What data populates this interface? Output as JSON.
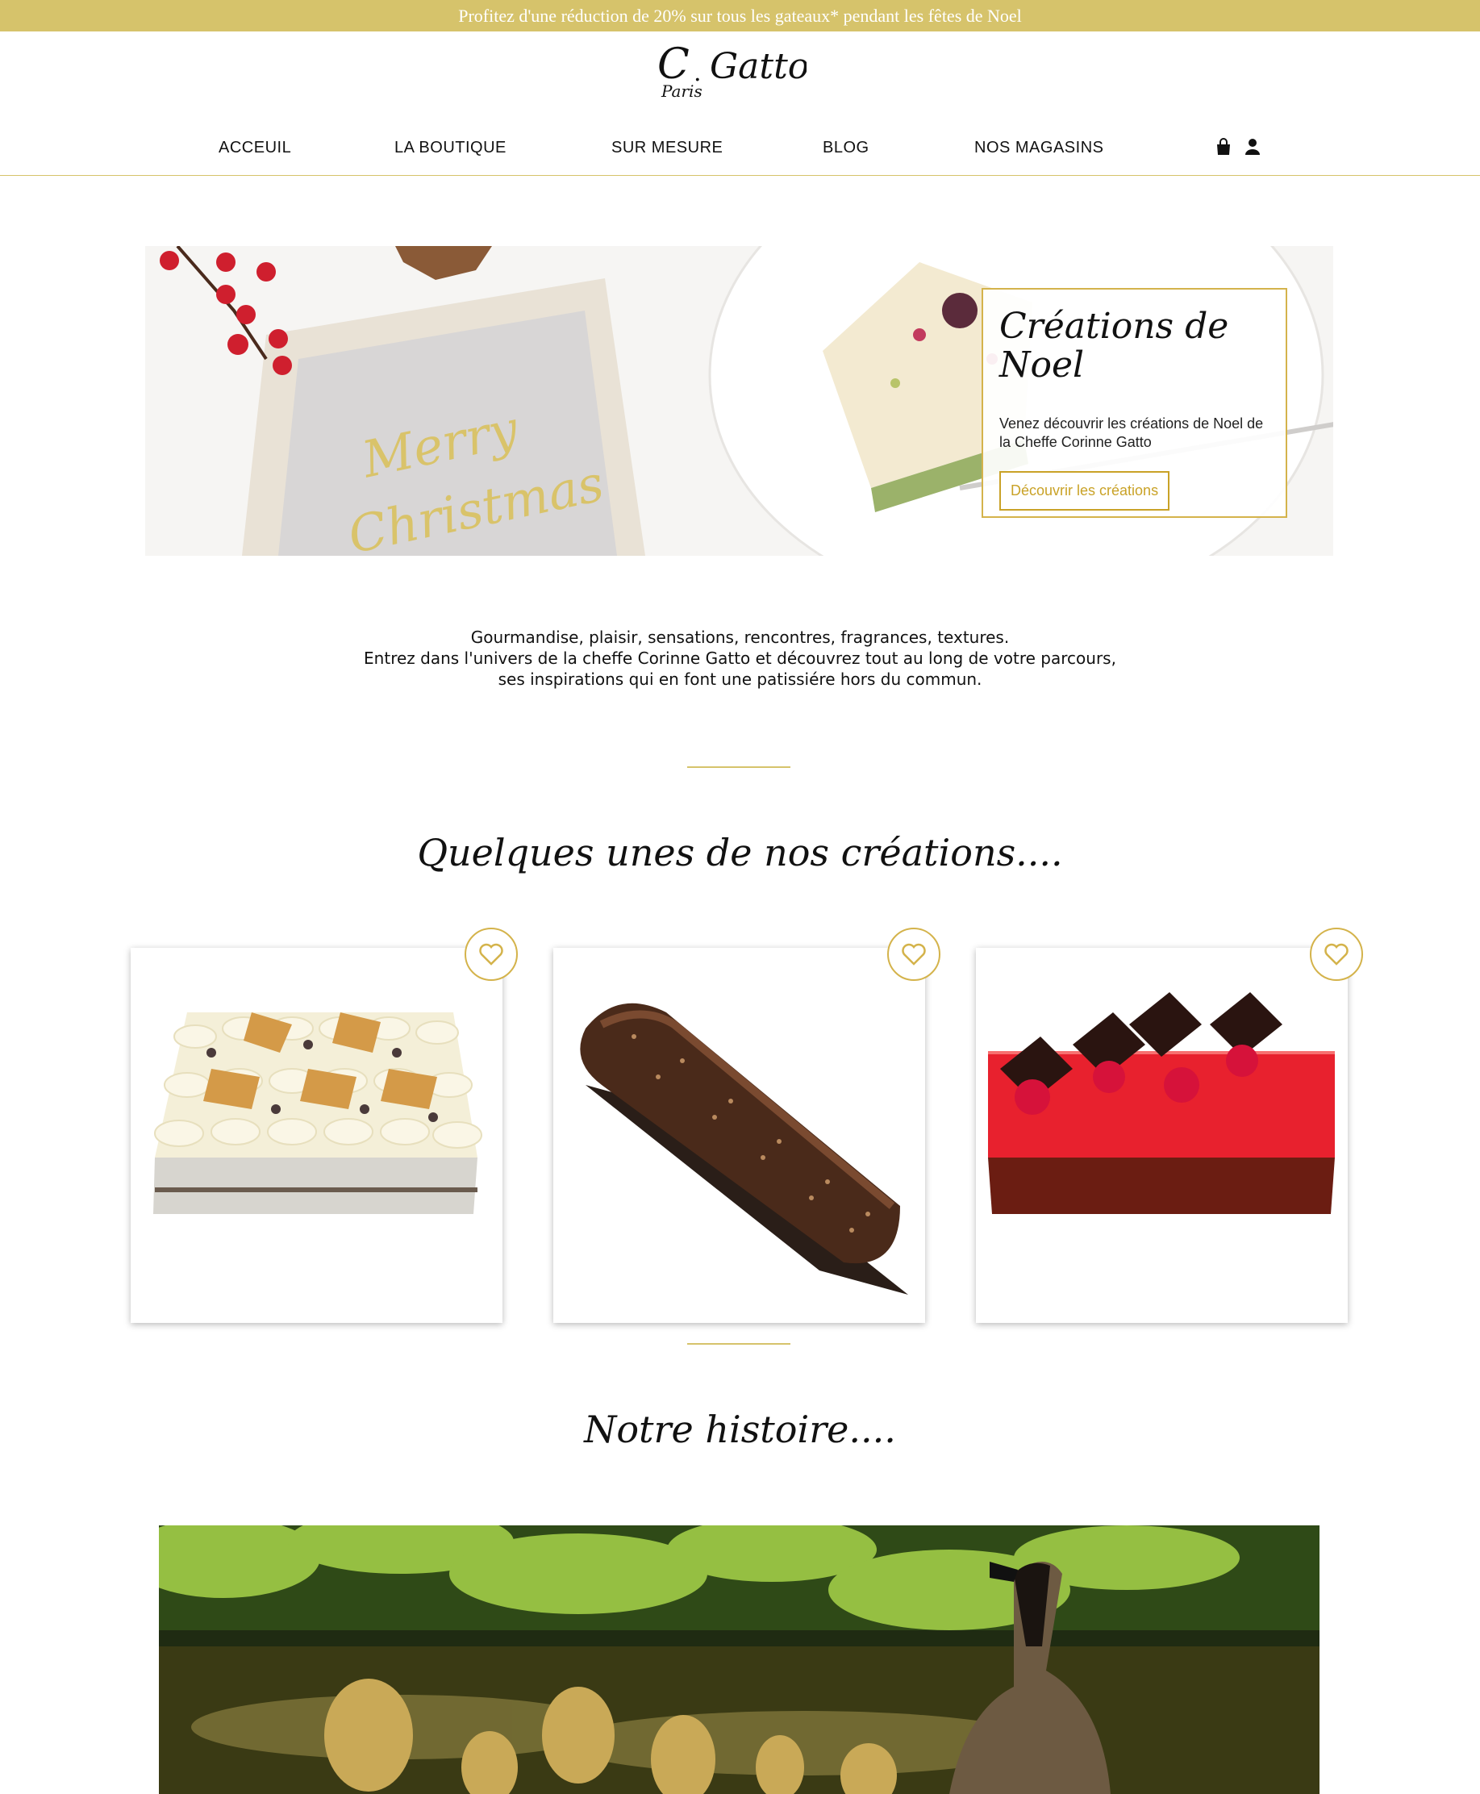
{
  "promo": {
    "text": "Profitez d'une réduction de 20% sur tous les gateaux* pendant les fêtes de Noel"
  },
  "brand": {
    "name": "C . Gatto",
    "city": "Paris",
    "accent": "#d6c36b",
    "button_color": "#c9a227"
  },
  "nav": {
    "items": [
      {
        "label": "ACCEUIL"
      },
      {
        "label": "LA BOUTIQUE"
      },
      {
        "label": "SUR MESURE"
      },
      {
        "label": "BLOG"
      },
      {
        "label": "NOS MAGASINS"
      }
    ],
    "icons": [
      "shopping-bag-icon",
      "user-icon"
    ]
  },
  "hero": {
    "title": "Créations de Noel",
    "text": "Venez découvrir les créations de Noel de la Cheffe Corinne Gatto",
    "button": "Découvrir les créations",
    "image_lettering": "Merry Christmas"
  },
  "intro": {
    "line1": "Gourmandise, plaisir, sensations, rencontres, fragrances, textures.",
    "line2": "Entrez dans l'univers de la cheffe Corinne Gatto et découvrez tout au long de votre parcours,",
    "line3": "ses inspirations qui en font une patissiére hors du commun."
  },
  "creations": {
    "title": "Quelques unes de nos créations....",
    "products": [
      {
        "image": "caramel-cream-cake",
        "icon": "heart-icon"
      },
      {
        "image": "chocolate-yule-log",
        "icon": "heart-icon"
      },
      {
        "image": "raspberry-tart",
        "icon": "heart-icon"
      }
    ]
  },
  "history": {
    "title": "Notre histoire....",
    "image": "geese-on-lake"
  }
}
